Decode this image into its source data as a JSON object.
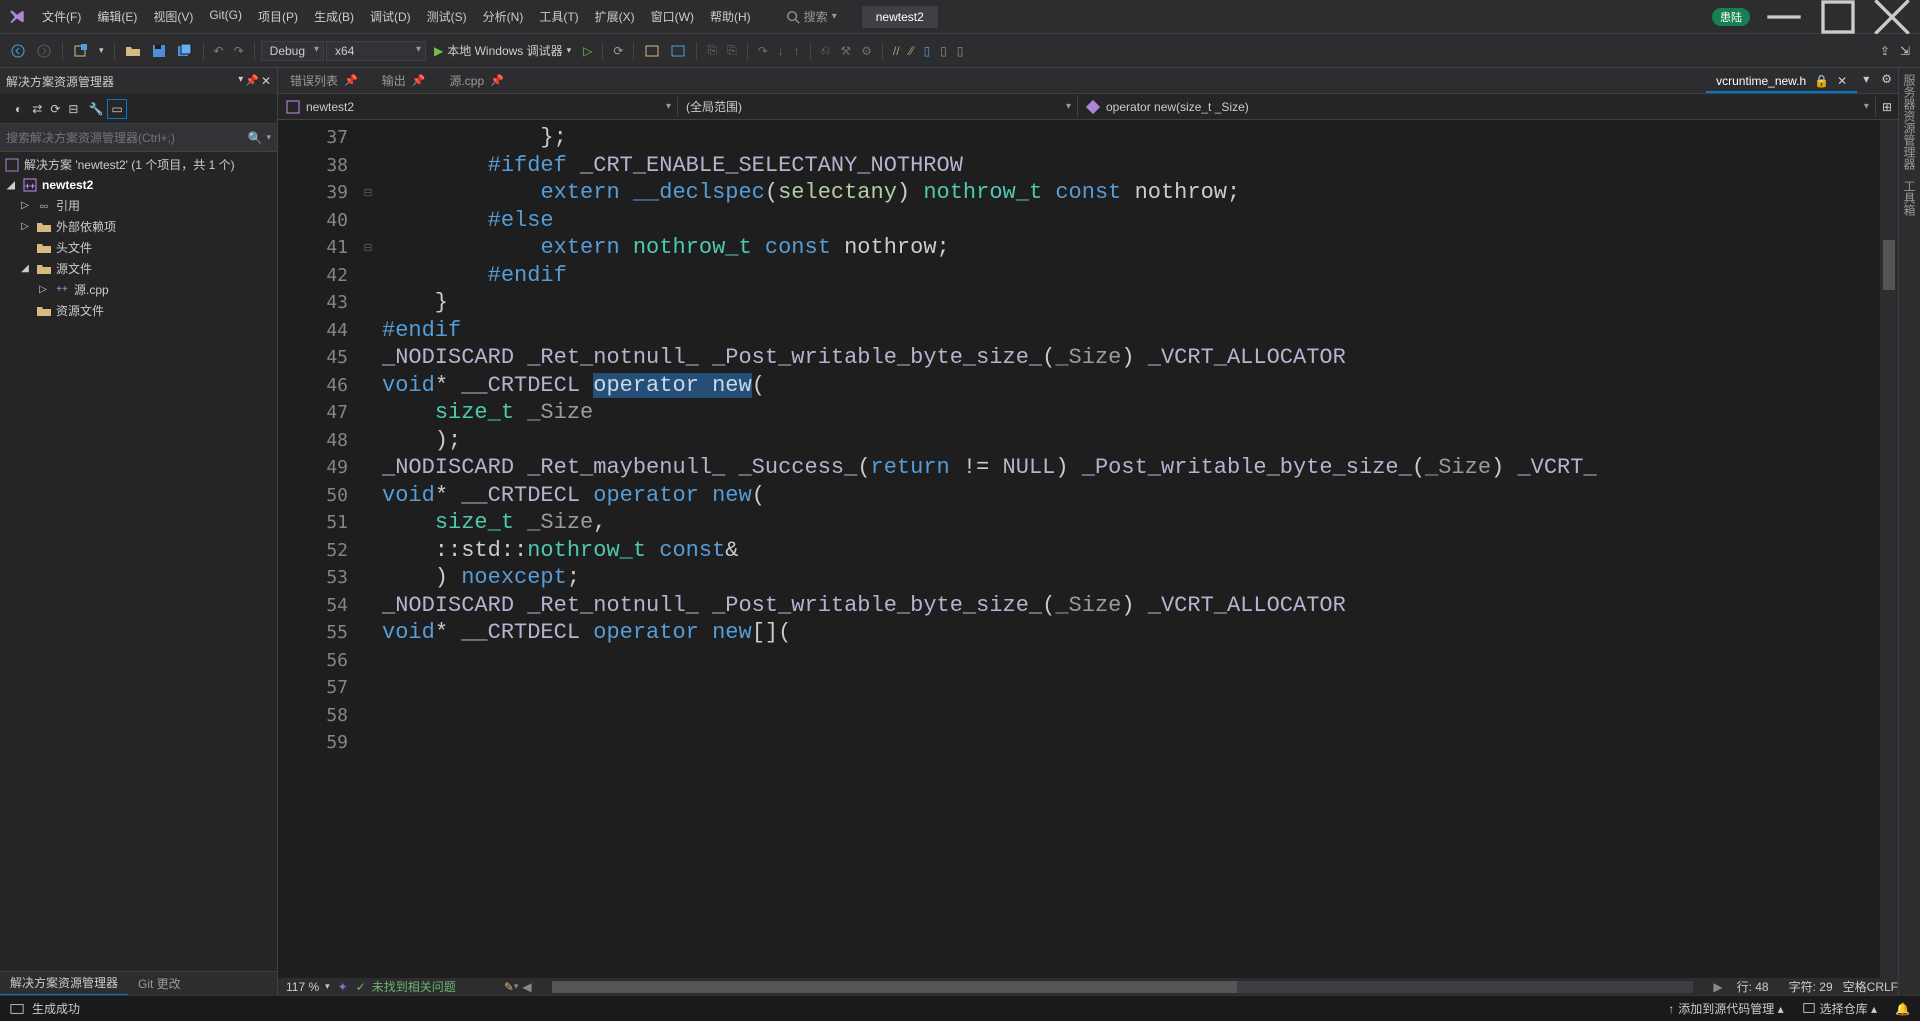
{
  "menu": [
    "文件(F)",
    "编辑(E)",
    "视图(V)",
    "Git(G)",
    "项目(P)",
    "生成(B)",
    "调试(D)",
    "测试(S)",
    "分析(N)",
    "工具(T)",
    "扩展(X)",
    "窗口(W)",
    "帮助(H)"
  ],
  "search_label": "搜索",
  "active_project": "newtest2",
  "user_badge": "患陆",
  "toolbar": {
    "config": "Debug",
    "platform": "x64",
    "debug_target": "本地 Windows 调试器"
  },
  "solution_explorer": {
    "title": "解决方案资源管理器",
    "search_placeholder": "搜索解决方案资源管理器(Ctrl+;)",
    "root": "解决方案 'newtest2' (1 个项目，共 1 个)",
    "project": "newtest2",
    "nodes": {
      "refs": "引用",
      "external": "外部依赖项",
      "headers": "头文件",
      "sources": "源文件",
      "source_file": "源.cpp",
      "resources": "资源文件"
    },
    "tabs": {
      "explorer": "解决方案资源管理器",
      "git": "Git 更改"
    }
  },
  "doc_tabs": {
    "errors": "错误列表",
    "output": "输出",
    "source": "源.cpp",
    "active": "vcruntime_new.h"
  },
  "dropdowns": {
    "project": "newtest2",
    "scope": "(全局范围)",
    "member": "operator new(size_t _Size)"
  },
  "line_numbers": [
    "37",
    "38",
    "39",
    "40",
    "41",
    "42",
    "43",
    "44",
    "45",
    "46",
    "47",
    "48",
    "49",
    "50",
    "51",
    "52",
    "53",
    "54",
    "55",
    "56",
    "57",
    "58",
    "59"
  ],
  "code_tokens": {
    "l37": [
      "            };"
    ],
    "l38": [
      ""
    ],
    "l39": [
      "        ",
      {
        "k": "#ifdef"
      },
      " ",
      {
        "m": "_CRT_ENABLE_SELECTANY_NOTHROW"
      }
    ],
    "l40": [
      "            ",
      {
        "k": "extern"
      },
      " ",
      {
        "k": "__declspec"
      },
      "(",
      {
        "o": "selectany"
      },
      ") ",
      {
        "t": "nothrow_t"
      },
      " ",
      {
        "k": "const"
      },
      " nothrow;"
    ],
    "l41": [
      "        ",
      {
        "k": "#else"
      }
    ],
    "l42": [
      "            ",
      {
        "k": "extern"
      },
      " ",
      {
        "t": "nothrow_t"
      },
      " ",
      {
        "k": "const"
      },
      " nothrow;"
    ],
    "l43": [
      "        ",
      {
        "k": "#endif"
      }
    ],
    "l44": [
      "    }"
    ],
    "l45": [
      {
        "k": "#endif"
      }
    ],
    "l46": [
      ""
    ],
    "l47": [
      {
        "m": "_NODISCARD"
      },
      " ",
      {
        "m": "_Ret_notnull_"
      },
      " ",
      {
        "m": "_Post_writable_byte_size_"
      },
      "(",
      {
        "d": "_Size"
      },
      ") ",
      {
        "m": "_VCRT_ALLOCATOR"
      }
    ],
    "l48": [
      {
        "k": "void"
      },
      "* ",
      {
        "m": "__CRTDECL"
      },
      " ",
      {
        "sel": "operator new"
      },
      "("
    ],
    "l49": [
      "    ",
      {
        "t": "size_t"
      },
      " ",
      {
        "d": "_Size"
      }
    ],
    "l50": [
      "    );"
    ],
    "l51": [
      ""
    ],
    "l52": [
      {
        "m": "_NODISCARD"
      },
      " ",
      {
        "m": "_Ret_maybenull_"
      },
      " ",
      {
        "m": "_Success_"
      },
      "(",
      {
        "k": "return"
      },
      " != ",
      {
        "m": "NULL"
      },
      ") ",
      {
        "m": "_Post_writable_byte_size_"
      },
      "(",
      {
        "d": "_Size"
      },
      ") ",
      {
        "m": "_VCRT_"
      }
    ],
    "l53": [
      {
        "k": "void"
      },
      "* ",
      {
        "m": "__CRTDECL"
      },
      " ",
      {
        "k": "operator"
      },
      " ",
      {
        "k": "new"
      },
      "("
    ],
    "l54": [
      "    ",
      {
        "t": "size_t"
      },
      " ",
      {
        "d": "_Size"
      },
      ","
    ],
    "l55": [
      "    ::std::",
      {
        "t": "nothrow_t"
      },
      " ",
      {
        "k": "const"
      },
      "&"
    ],
    "l56": [
      "    ) ",
      {
        "k": "noexcept"
      },
      ";"
    ],
    "l57": [
      ""
    ],
    "l58": [
      {
        "m": "_NODISCARD"
      },
      " ",
      {
        "m": "_Ret_notnull_"
      },
      " ",
      {
        "m": "_Post_writable_byte_size_"
      },
      "(",
      {
        "d": "_Size"
      },
      ") ",
      {
        "m": "_VCRT_ALLOCATOR"
      }
    ],
    "l59": [
      {
        "k": "void"
      },
      "* ",
      {
        "m": "__CRTDECL"
      },
      " ",
      {
        "k": "operator"
      },
      " ",
      {
        "k": "new"
      },
      "[]("
    ]
  },
  "bottom": {
    "zoom": "117 %",
    "issues": "未找到相关问题",
    "line": "行: 48",
    "col": "字符: 29",
    "ins": "空格",
    "eol": "CRLF"
  },
  "status": {
    "build": "生成成功",
    "scm": "添加到源代码管理",
    "repo": "选择仓库"
  },
  "right_rail": [
    "服务器资源管理器",
    "工具箱"
  ]
}
